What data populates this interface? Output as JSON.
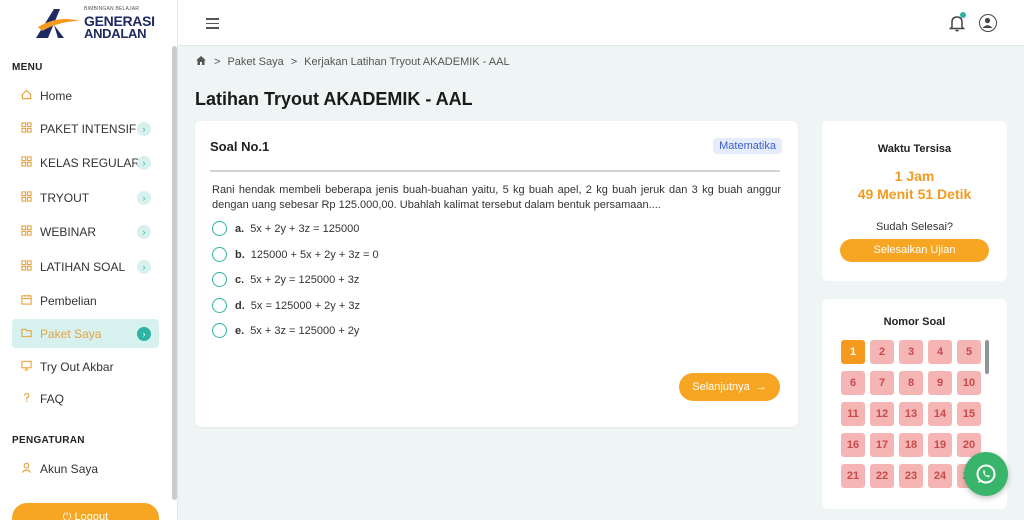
{
  "logo": {
    "tagline": "BIMBINGAN BELAJAR",
    "line1": "GENERASI",
    "line2": "ANDALAN"
  },
  "sidebar": {
    "menu_heading": "MENU",
    "items": [
      {
        "label": "Home",
        "icon": "home-icon",
        "expandable": false,
        "active": false
      },
      {
        "label": "PAKET INTENSIF",
        "icon": "grid-icon",
        "expandable": true,
        "active": false
      },
      {
        "label": "KELAS REGULAR",
        "icon": "grid-icon",
        "expandable": true,
        "active": false
      },
      {
        "label": "TRYOUT",
        "icon": "grid-icon",
        "expandable": true,
        "active": false
      },
      {
        "label": "WEBINAR",
        "icon": "grid-icon",
        "expandable": true,
        "active": false
      },
      {
        "label": "LATIHAN SOAL",
        "icon": "grid-icon",
        "expandable": true,
        "active": false
      },
      {
        "label": "Pembelian",
        "icon": "calendar-icon",
        "expandable": false,
        "active": false
      },
      {
        "label": "Paket Saya",
        "icon": "folder-icon",
        "expandable": true,
        "active": true
      },
      {
        "label": "Try Out Akbar",
        "icon": "monitor-icon",
        "expandable": false,
        "active": false
      },
      {
        "label": "FAQ",
        "icon": "question-icon",
        "expandable": false,
        "active": false
      }
    ],
    "settings_heading": "PENGATURAN",
    "account_label": "Akun Saya",
    "logout_label": "Logout"
  },
  "breadcrumb": {
    "level1": "Paket Saya",
    "level2": "Kerjakan Latihan Tryout AKADEMIK - AAL"
  },
  "page_title": "Latihan Tryout AKADEMIK - AAL",
  "question": {
    "number_label": "Soal No.1",
    "subject": "Matematika",
    "text": "Rani hendak membeli beberapa jenis buah-buahan yaitu, 5 kg buah apel, 2 kg buah jeruk dan 3 kg buah anggur dengan uang sebesar Rp 125.000,00. Ubahlah kalimat tersebut dalam bentuk persamaan....",
    "options": [
      {
        "letter": "a.",
        "text": "5x + 2y + 3z = 125000"
      },
      {
        "letter": "b.",
        "text": "125000 + 5x + 2y + 3z = 0"
      },
      {
        "letter": "c.",
        "text": "5x + 2y = 125000 + 3z"
      },
      {
        "letter": "d.",
        "text": "5x = 125000 + 2y + 3z"
      },
      {
        "letter": "e.",
        "text": "5x + 3z = 125000 + 2y"
      }
    ],
    "next_label": "Selanjutnya"
  },
  "timer": {
    "label": "Waktu Tersisa",
    "hours": "1 Jam",
    "minutes_seconds": "49 Menit 51 Detik",
    "done_prompt": "Sudah Selesai?",
    "finish_label": "Selesaikan Ujian"
  },
  "numbers": {
    "title": "Nomor Soal",
    "current": "1",
    "visible": [
      "1",
      "2",
      "3",
      "4",
      "5",
      "6",
      "7",
      "8",
      "9",
      "10",
      "11",
      "12",
      "13",
      "14",
      "15",
      "16",
      "17",
      "18",
      "19",
      "20",
      "21",
      "22",
      "23",
      "24",
      "25"
    ]
  },
  "colors": {
    "accent": "#f6a623",
    "teal": "#2fb3a5",
    "unanswered": "#f5b5b5"
  }
}
